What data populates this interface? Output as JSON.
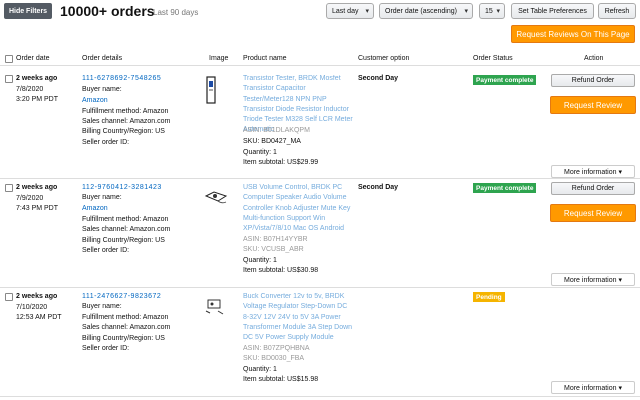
{
  "toolbar": {
    "hide_filters": "Hide Filters",
    "title": "10000+ orders",
    "subtitle": "Last 90 days",
    "range_select": "Last day",
    "sort_select": "Order date (ascending)",
    "per_page_select": "15",
    "table_prefs": "Set Table Preferences",
    "refresh": "Refresh",
    "request_all": "Request Reviews On This Page"
  },
  "columns": {
    "order_date": "Order date",
    "order_details": "Order details",
    "image": "Image",
    "product_name": "Product name",
    "customer_option": "Customer option",
    "order_status": "Order Status",
    "action": "Action"
  },
  "labels": {
    "buyer_name": "Buyer name:",
    "fulfillment": "Fulfillment method: Amazon",
    "sales_channel": "Sales channel: Amazon.com",
    "billing": "Billing Country/Region: US",
    "seller_order_id": "Seller order ID:",
    "refund": "Refund Order",
    "request_review": "Request Review",
    "more_info": "More information ▾"
  },
  "orders": [
    {
      "relative": "2 weeks ago",
      "date": "7/8/2020",
      "time": "3:20 PM PDT",
      "order_id": "111-6278692-7548265",
      "buyer": "Amazon",
      "product": "Transistor Tester, BRDK Mosfet Transistor Capacitor Tester/Meter128 NPN PNP Transistor Diode Resistor Inductor Triode Tester M328 Self LCR Meter Automatic",
      "asin": "ASIN: B01DLAKQPM",
      "sku": "SKU: BD0427_MA",
      "quantity": "Quantity: 1",
      "subtotal": "Item subtotal: US$29.99",
      "customer_option": "Second Day",
      "status": "Payment complete"
    },
    {
      "relative": "2 weeks ago",
      "date": "7/9/2020",
      "time": "7:43 PM PDT",
      "order_id": "112-9760412-3281423",
      "buyer": "Amazon",
      "product": "USB Volume Control, BRDK PC Computer Speaker Audio Volume Controller Knob Adjuster Mute Key Multi-function Support Win XP/Vista/7/8/10 Mac OS Android",
      "asin": "ASIN: B07H14YYBR",
      "sku": "SKU: VCUSB_ABR",
      "quantity": "Quantity: 1",
      "subtotal": "Item subtotal: US$30.98",
      "customer_option": "Second Day",
      "status": "Payment complete"
    },
    {
      "relative": "2 weeks ago",
      "date": "7/10/2020",
      "time": "12:53 AM PDT",
      "order_id": "111-2476627-9823672",
      "buyer": "",
      "product": "Buck Converter 12v to 5v, BRDK Voltage Regulator Step-Down DC 8-32V 12V 24V to 5V 3A Power Transformer Module 3A Step Down DC 5V Power Supply Module",
      "asin": "ASIN: B07ZPQHBNA",
      "sku": "SKU: BD0030_FBA",
      "quantity": "Quantity: 1",
      "subtotal": "Item subtotal: US$15.98",
      "customer_option": "",
      "status": "Pending"
    }
  ],
  "colors": {
    "link": "#0066c0",
    "review_button": "#ff9900",
    "status_complete": "#2ea44f",
    "status_pending": "#f5b400"
  }
}
